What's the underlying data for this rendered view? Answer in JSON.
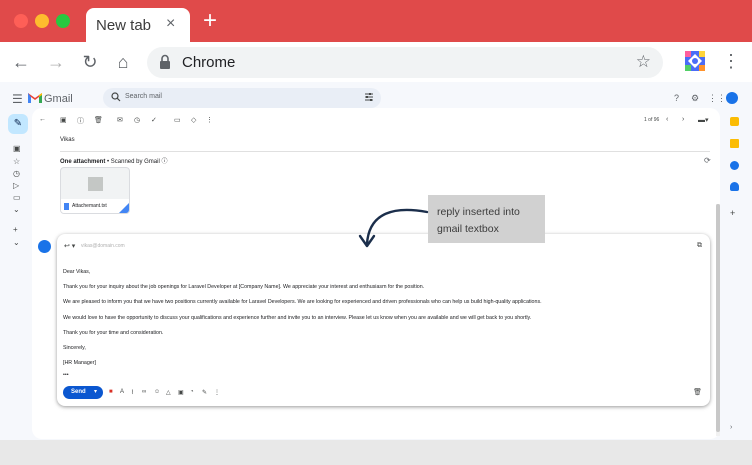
{
  "browser": {
    "tab_title": "New tab",
    "tab_close": "×",
    "new_tab": "+",
    "omnibox_text": "Chrome",
    "back": "←",
    "forward": "→",
    "reload": "↻",
    "home": "⌂",
    "bookmark": "☆",
    "menu": "⋮"
  },
  "gmail": {
    "app_name": "Gmail",
    "search_placeholder": "Search mail",
    "pagination": "1 of 96",
    "sender": "Vikas",
    "attachments_label": "One attachment",
    "scanned_label": " • Scanned by Gmail ⓘ",
    "attachment_name": "Attachemant.txt",
    "reply": {
      "to_placeholder": "vikas@domain.com",
      "paragraphs": [
        "Dear Vikas,",
        "Thank you for your inquiry about the job openings for Laravel Developer at [Company Name]. We appreciate your interest and enthusiasm for the position.",
        "We are pleased to inform you that we have two positions currently available for Laravel Developers. We are looking for experienced and driven professionals who can help us build high-quality applications.",
        "We would love to have the opportunity to discuss your qualifications and experience further and invite you to an interview. Please let us know when you are available and we will get back to you shortly.",
        "Thank you for your time and consideration.",
        "Sincerely,",
        "[HR Manager]",
        "•••"
      ],
      "send_label": "Send"
    }
  },
  "annotation": {
    "text": "reply inserted into\ngmail textbox"
  },
  "colors": {
    "titlebar": "#e04a4a",
    "send": "#0b57d0",
    "arrow": "#1b2e4b"
  }
}
